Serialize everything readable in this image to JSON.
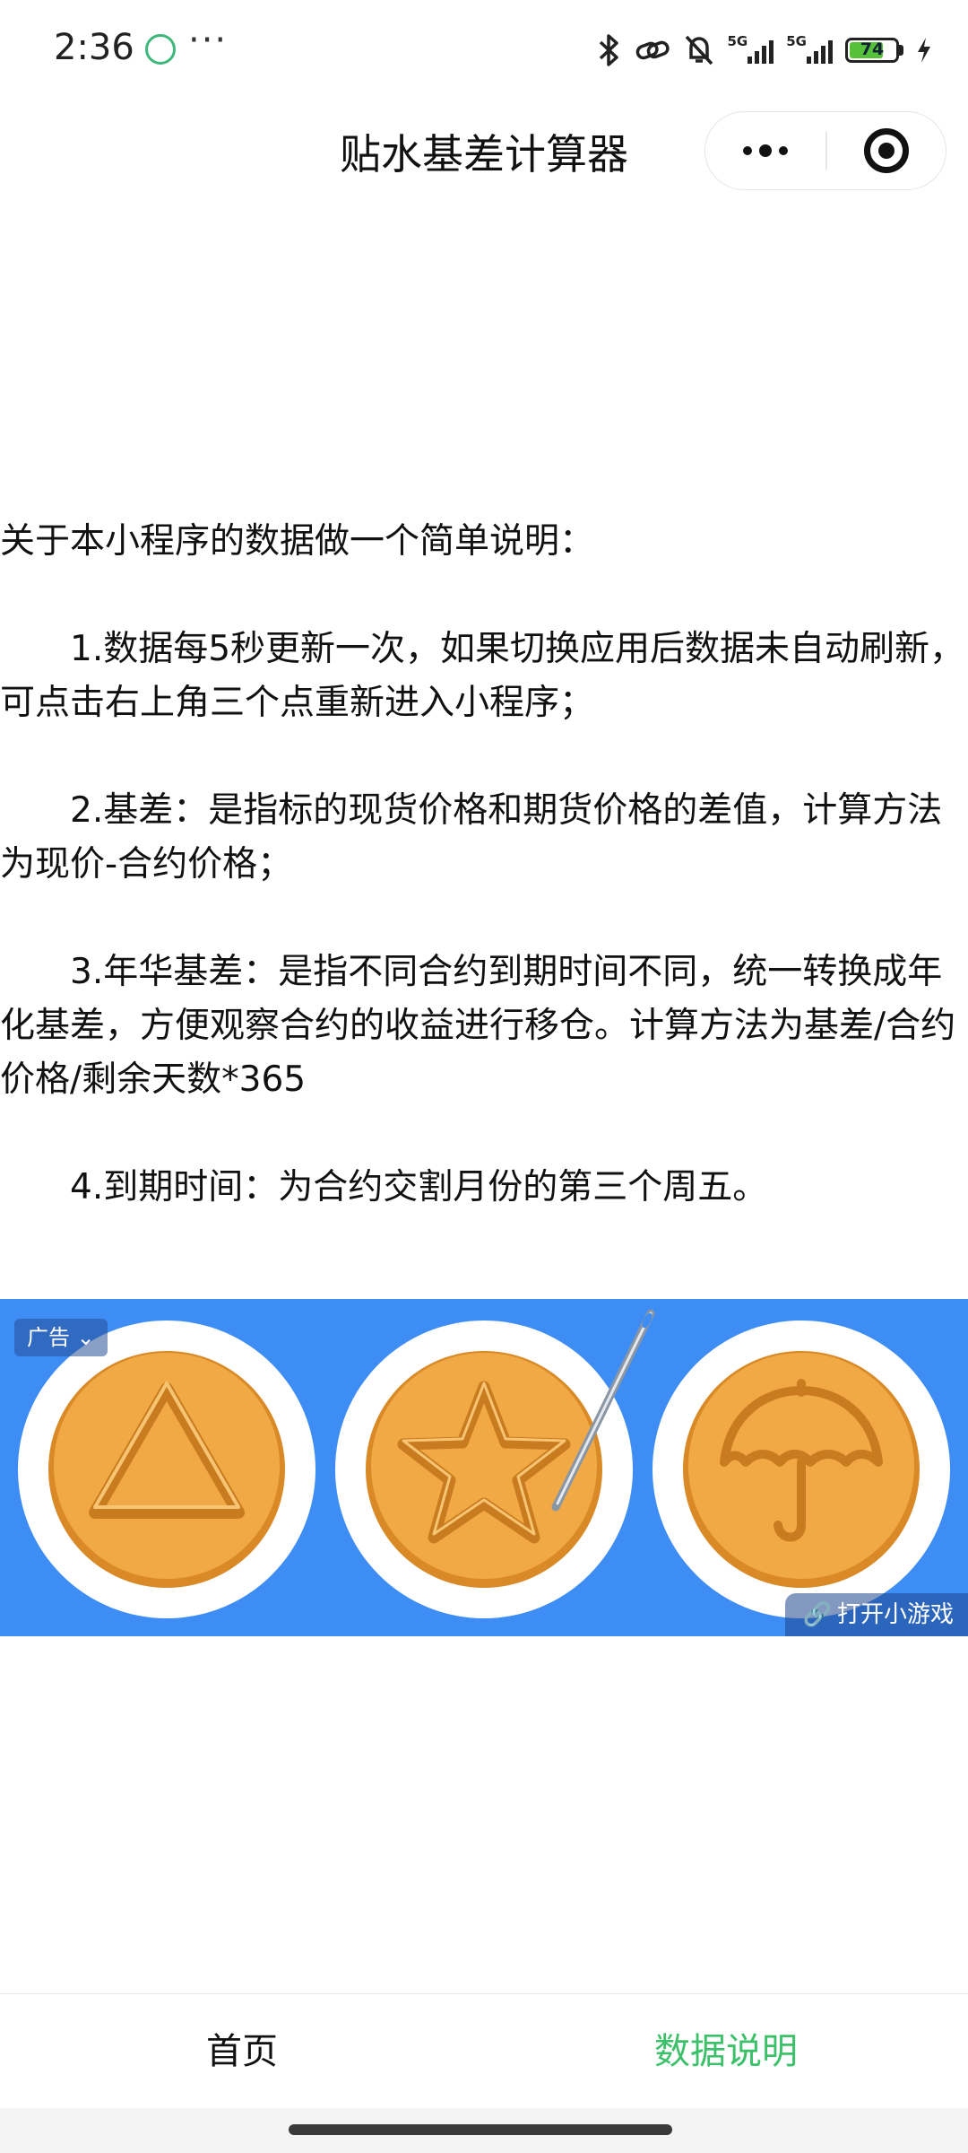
{
  "status_bar": {
    "time": "2:36",
    "more": "···",
    "signal1_label": "5G",
    "signal2_label": "5G",
    "battery_level": 74,
    "battery_text": "74"
  },
  "nav": {
    "title": "贴水基差计算器"
  },
  "content": {
    "intro": "关于本小程序的数据做一个简单说明：",
    "items": [
      "1.数据每5秒更新一次，如果切换应用后数据未自动刷新，可点击右上角三个点重新进入小程序；",
      "2.基差：是指标的现货价格和期货价格的差值，计算方法为现价-合约价格；",
      "3.年华基差：是指不同合约到期时间不同，统一转换成年化基差，方便观察合约的收益进行移仓。计算方法为基差/合约价格/剩余天数*365",
      "4.到期时间：为合约交割月份的第三个周五。"
    ]
  },
  "ad": {
    "badge": "广告",
    "open_button": "打开小游戏",
    "coins": [
      "triangle-icon",
      "star-icon",
      "umbrella-icon"
    ],
    "colors": {
      "background": "#3d8df5",
      "coin": "#f0a945",
      "coin_edge": "#d98a26"
    }
  },
  "tabbar": {
    "tabs": [
      {
        "label": "首页",
        "active": false
      },
      {
        "label": "数据说明",
        "active": true
      }
    ],
    "active_color": "#3cc16a"
  }
}
